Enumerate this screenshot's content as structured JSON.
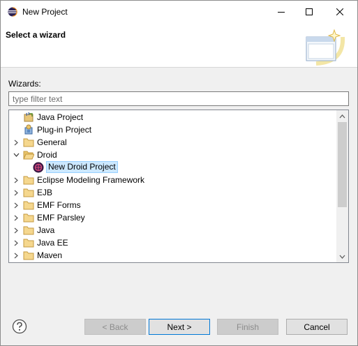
{
  "window": {
    "title": "New Project"
  },
  "banner": {
    "title": "Select a wizard"
  },
  "wizards": {
    "label": "Wizards:"
  },
  "filter": {
    "placeholder": "type filter text",
    "value": ""
  },
  "tree": {
    "items": [
      {
        "label": "Java Project",
        "icon": "java-project-icon",
        "expandable": false
      },
      {
        "label": "Plug-in Project",
        "icon": "plugin-project-icon",
        "expandable": false
      },
      {
        "label": "General",
        "icon": "folder-icon",
        "expandable": true,
        "expanded": false
      },
      {
        "label": "Droid",
        "icon": "folder-icon",
        "expandable": true,
        "expanded": true
      },
      {
        "label": "New Droid Project",
        "icon": "droid-project-icon",
        "expandable": false,
        "selected": true
      },
      {
        "label": "Eclipse Modeling Framework",
        "icon": "folder-icon",
        "expandable": true,
        "expanded": false
      },
      {
        "label": "EJB",
        "icon": "folder-icon",
        "expandable": true,
        "expanded": false
      },
      {
        "label": "EMF Forms",
        "icon": "folder-icon",
        "expandable": true,
        "expanded": false
      },
      {
        "label": "EMF Parsley",
        "icon": "folder-icon",
        "expandable": true,
        "expanded": false
      },
      {
        "label": "Java",
        "icon": "folder-icon",
        "expandable": true,
        "expanded": false
      },
      {
        "label": "Java EE",
        "icon": "folder-icon",
        "expandable": true,
        "expanded": false
      },
      {
        "label": "Maven",
        "icon": "folder-icon",
        "expandable": true,
        "expanded": false
      }
    ]
  },
  "buttons": {
    "back": "< Back",
    "next": "Next >",
    "finish": "Finish",
    "cancel": "Cancel"
  },
  "colors": {
    "selection": "#cce8ff",
    "folder": "#dcb67a",
    "default_button_border": "#0078d7"
  }
}
